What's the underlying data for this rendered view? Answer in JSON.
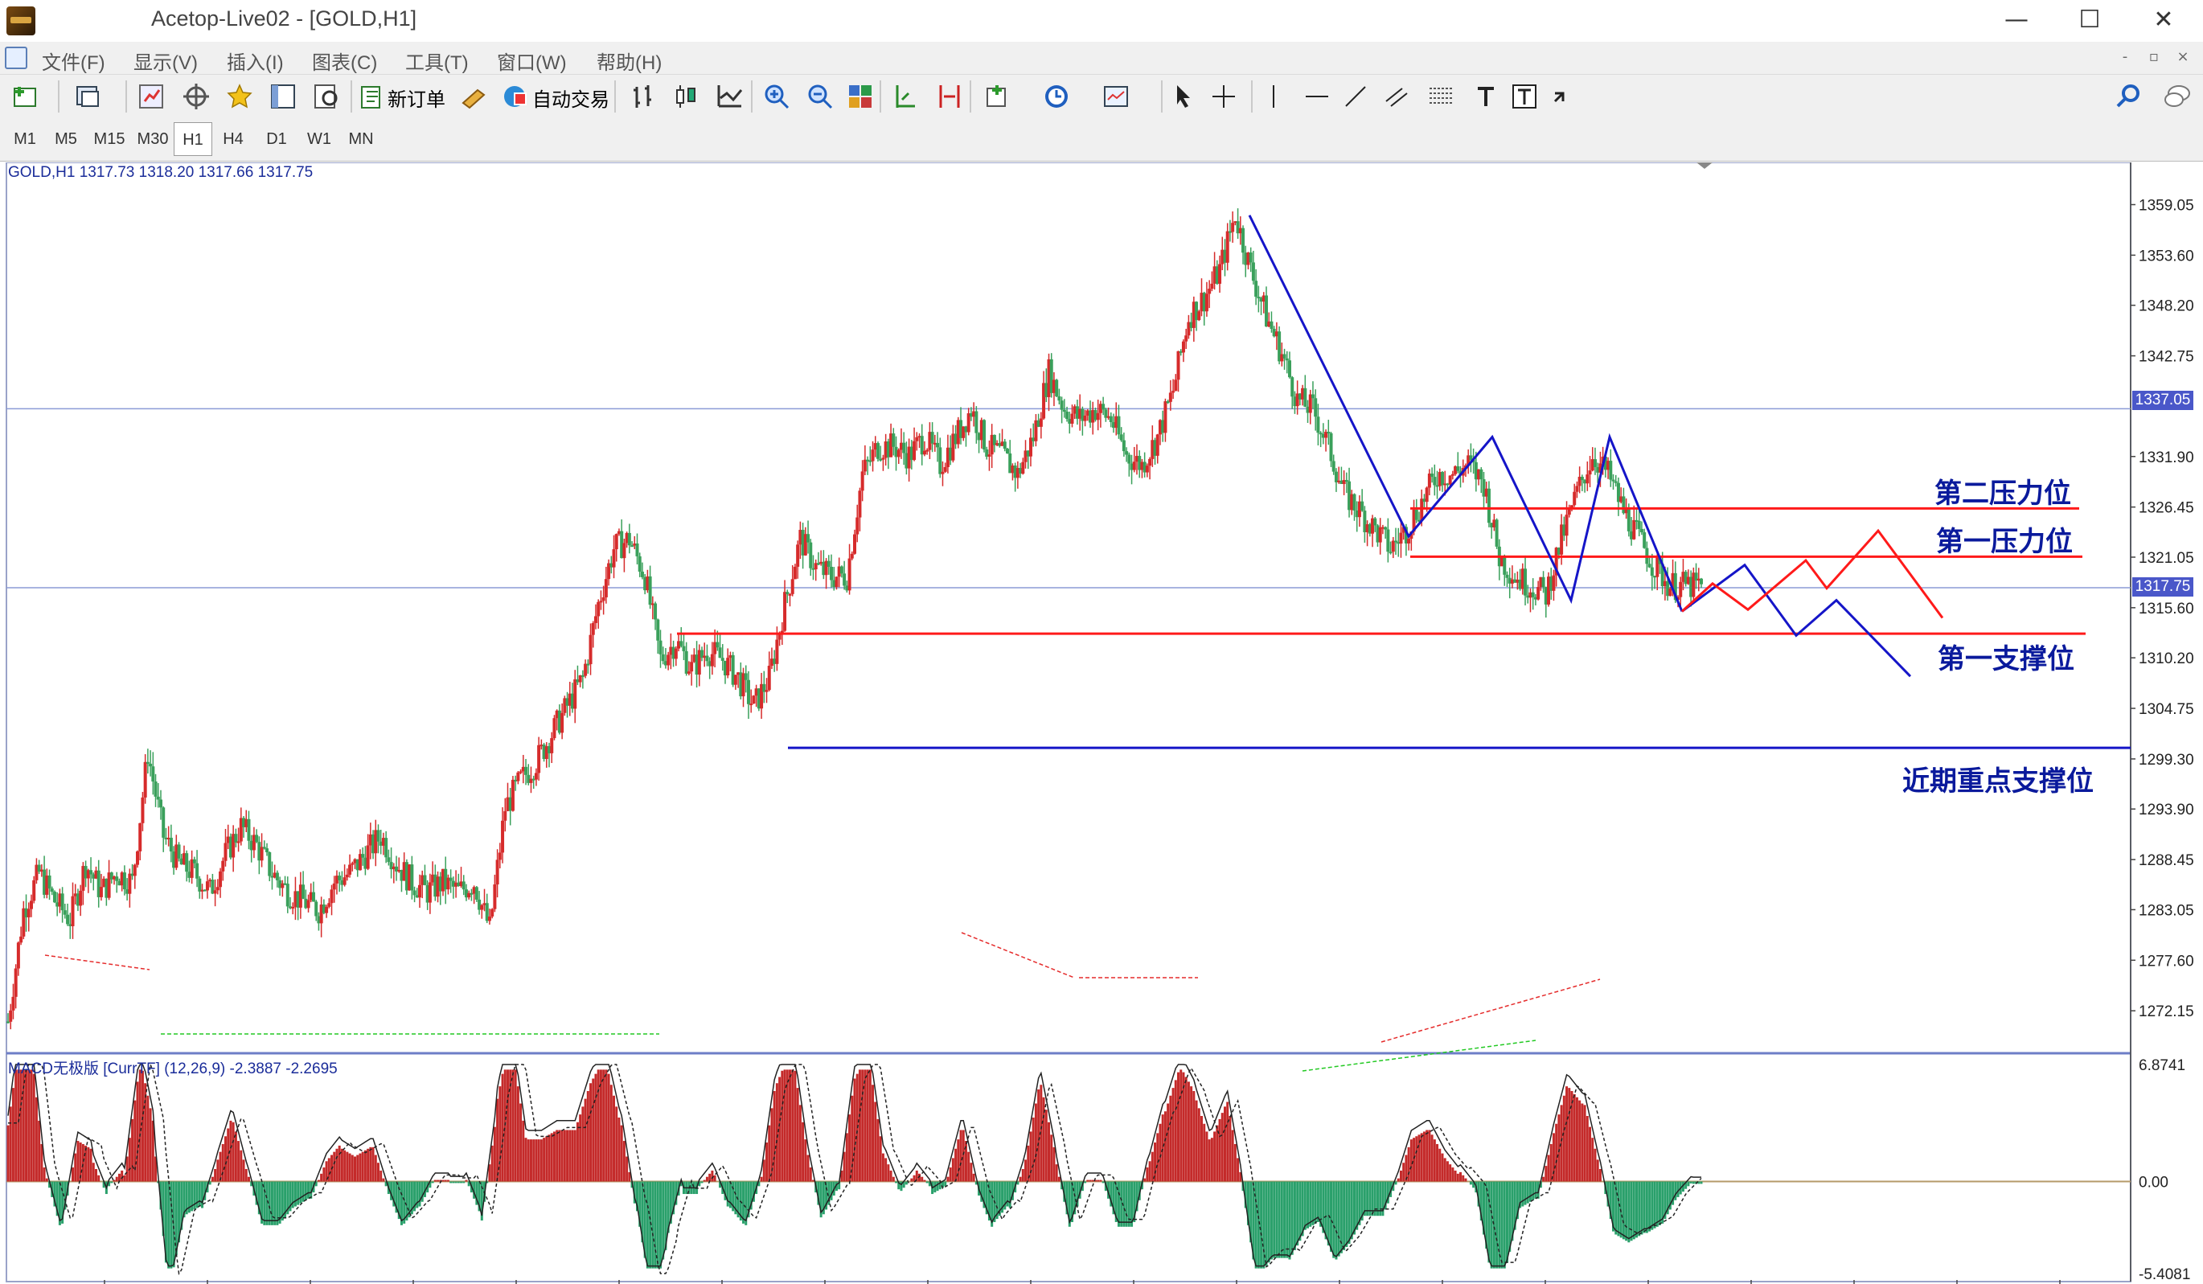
{
  "window": {
    "title": "Acetop-Live02 - [GOLD,H1]",
    "minimize_glyph": "—",
    "maximize_glyph": "☐",
    "close_glyph": "✕"
  },
  "menu": {
    "items": [
      "文件(F)",
      "显示(V)",
      "插入(I)",
      "图表(C)",
      "工具(T)",
      "窗口(W)",
      "帮助(H)"
    ],
    "mdi_minimize": "-",
    "mdi_restore": "▫",
    "mdi_close": "×"
  },
  "toolbar": {
    "new_order_label": "新订单",
    "auto_trade_label": "自动交易",
    "icons": [
      "new-chart-icon",
      "profiles-icon",
      "market-watch-icon",
      "navigator-icon",
      "favorites-icon",
      "terminal-icon",
      "strategy-tester-icon",
      "new-order-icon",
      "metaeditor-icon",
      "auto-trading-icon",
      "bar-chart-icon",
      "candlestick-icon",
      "line-chart-icon",
      "zoom-in-icon",
      "zoom-out-icon",
      "tile-windows-icon",
      "auto-scroll-icon",
      "chart-shift-icon",
      "indicators-icon",
      "periods-icon",
      "templates-icon",
      "cursor-icon",
      "crosshair-icon",
      "vertical-line-icon",
      "horizontal-line-icon",
      "trendline-icon",
      "equidistant-channel-icon",
      "fibonacci-icon",
      "text-icon",
      "text-label-icon",
      "arrows-icon",
      "search-icon",
      "chat-icon"
    ]
  },
  "periods": {
    "items": [
      "M1",
      "M5",
      "M15",
      "M30",
      "H1",
      "H4",
      "D1",
      "W1",
      "MN"
    ],
    "active": "H1"
  },
  "chart": {
    "info": "GOLD,H1  1317.73 1318.20 1317.66 1317.75",
    "macd_info": "MACD无极版 [CurrTF] (12,26,9) -2.3887 -2.2695",
    "current_price_tag": "1317.75",
    "line_price_tag": "1337.05",
    "labels": {
      "resistance2": "第二压力位",
      "resistance1": "第一压力位",
      "support1": "第一支撑位",
      "key_support": "近期重点支撑位"
    },
    "colors": {
      "bull": "#d62b2b",
      "bear": "#3aa05b",
      "resistance": "#ff1a1a",
      "support_line": "#1515c8",
      "projection_blue": "#1515c8",
      "projection_red": "#ff1a1a",
      "histogram_up": "#c42a2a",
      "histogram_down": "#2aa06b",
      "price_tag_bg": "#4a57c9",
      "grid_line": "#8c9bd6"
    }
  },
  "chart_data": {
    "type": "candlestick",
    "symbol": "GOLD",
    "timeframe": "H1",
    "ohlc_last": {
      "open": 1317.73,
      "high": 1318.2,
      "low": 1317.66,
      "close": 1317.75
    },
    "y_ticks": [
      "1359.05",
      "1353.60",
      "1348.20",
      "1342.75",
      "1337.05",
      "1331.90",
      "1326.45",
      "1321.05",
      "1317.75",
      "1315.60",
      "1310.20",
      "1304.75",
      "1299.30",
      "1293.90",
      "1288.45",
      "1283.05",
      "1277.60",
      "1272.15"
    ],
    "ylim": [
      1270,
      1361
    ],
    "path": [
      1271,
      1283,
      1287,
      1284,
      1282,
      1288,
      1285,
      1287,
      1286,
      1300,
      1291,
      1288,
      1287,
      1285,
      1289,
      1292,
      1290,
      1287,
      1285,
      1284,
      1283,
      1286,
      1287,
      1289,
      1291,
      1288,
      1286,
      1285,
      1286,
      1285,
      1286,
      1281,
      1294,
      1297,
      1299,
      1302,
      1305,
      1308,
      1316,
      1322,
      1323,
      1319,
      1310,
      1312,
      1309,
      1311,
      1310,
      1308,
      1305,
      1308,
      1316,
      1323,
      1320,
      1319,
      1319,
      1330,
      1333,
      1333,
      1332,
      1334,
      1331,
      1334,
      1337,
      1333,
      1332,
      1330,
      1334,
      1341,
      1337,
      1336,
      1337,
      1336,
      1332,
      1331,
      1334,
      1339,
      1347,
      1349,
      1352,
      1358,
      1352,
      1347,
      1343,
      1338,
      1337,
      1333,
      1328,
      1326,
      1324,
      1322,
      1324,
      1327,
      1330,
      1330,
      1331,
      1329,
      1321,
      1319,
      1318,
      1317,
      1323,
      1328,
      1332,
      1330,
      1326,
      1323,
      1320,
      1318,
      1318,
      1317.75
    ],
    "levels": [
      {
        "name": "第二压力位",
        "value": 1326.3
      },
      {
        "name": "第一压力位",
        "value": 1321.1
      },
      {
        "name": "第一支撑位",
        "value": 1312.8
      },
      {
        "name": "近期重点支撑位",
        "value": 1300.5
      }
    ],
    "zigzag_blue_values": [
      1357.9,
      1323.3,
      1334.0,
      1316.4,
      1334.0,
      1315.2
    ],
    "projection_blue_values": [
      1315.2,
      1320.2,
      1312.6,
      1316.4,
      1308.2
    ],
    "projection_red_values": [
      1315.2,
      1318.2,
      1315.4,
      1320.7,
      1317.7,
      1323.9,
      1314.5
    ],
    "macd": {
      "ylim": [
        -5.4081,
        6.8741
      ],
      "ticks": [
        "6.8741",
        "0.00",
        "-5.4081"
      ],
      "signal": -2.3887,
      "value": -2.2695
    }
  }
}
